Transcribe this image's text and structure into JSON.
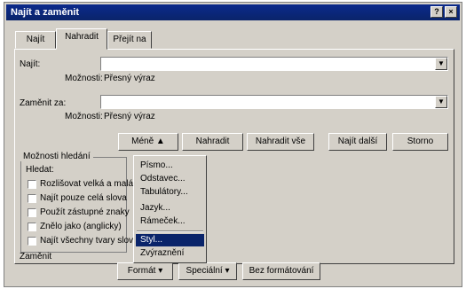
{
  "window": {
    "title": "Najít a zaměnit"
  },
  "titlebar_buttons": {
    "help": "?",
    "close": "×"
  },
  "tabs": [
    {
      "label": "Najít"
    },
    {
      "label": "Nahradit"
    },
    {
      "label": "Přejít na"
    }
  ],
  "find": {
    "label": "Najít:",
    "options_label": "Možnosti:",
    "options_value": "Přesný výraz",
    "value": ""
  },
  "replace": {
    "label": "Zaměnit za:",
    "options_label": "Možnosti:",
    "options_value": "Přesný výraz",
    "value": ""
  },
  "buttons": {
    "less": "Méně ▲",
    "replace": "Nahradit",
    "replace_all": "Nahradit vše",
    "find_next": "Najít další",
    "cancel": "Storno"
  },
  "search_options": {
    "title": "Možnosti hledání",
    "search_label": "Hledat:",
    "checkboxes": [
      "Rozlišovat velká a malá",
      "Najít pouze celá slova",
      "Použít zástupné znaky",
      "Znělo jako (anglicky)",
      "Najít všechny tvary slova"
    ]
  },
  "replace_section": {
    "label": "Zaměnit"
  },
  "bottom_buttons": {
    "format": "Formát ▾",
    "special": "Speciální ▾",
    "no_formatting": "Bez formátování"
  },
  "format_menu": {
    "items": [
      "Písmo...",
      "Odstavec...",
      "Tabulátory...",
      "Jazyk...",
      "Rámeček...",
      "Styl...",
      "Zvýraznění"
    ],
    "highlighted_index": 5
  }
}
